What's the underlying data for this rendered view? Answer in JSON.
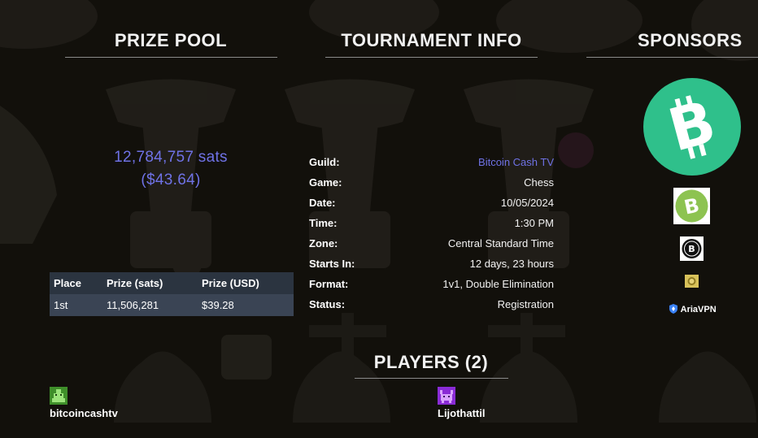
{
  "sections": {
    "prize_pool_title": "PRIZE POOL",
    "tournament_info_title": "TOURNAMENT INFO",
    "sponsors_title": "SPONSORS",
    "players_title": "PLAYERS (2)"
  },
  "prize_pool": {
    "sats": "12,784,757 sats",
    "usd": "($43.64)",
    "table": {
      "headers": [
        "Place",
        "Prize (sats)",
        "Prize (USD)"
      ],
      "rows": [
        [
          "1st",
          "11,506,281",
          "$39.28"
        ]
      ]
    }
  },
  "tournament_info": {
    "rows": [
      {
        "label": "Guild:",
        "value": "Bitcoin Cash TV",
        "is_link": true
      },
      {
        "label": "Game:",
        "value": "Chess"
      },
      {
        "label": "Date:",
        "value": "10/05/2024"
      },
      {
        "label": "Time:",
        "value": "1:30 PM"
      },
      {
        "label": "Zone:",
        "value": "Central Standard Time"
      },
      {
        "label": "Starts In:",
        "value": "12 days, 23 hours"
      },
      {
        "label": "Format:",
        "value": "1v1, Double Elimination"
      },
      {
        "label": "Status:",
        "value": "Registration"
      }
    ]
  },
  "sponsors": {
    "logos": [
      "bitcoin-cash-logo-large",
      "bitcoin-cash-logo-small",
      "bitcoin-circle-logo",
      "gold-coin-logo",
      "ariavpn-logo"
    ],
    "ariavpn_label": "AriaVPN"
  },
  "players": [
    {
      "name": "bitcoincashtv",
      "avatar_color": "#3f8f2a"
    },
    {
      "name": "Lijothattil",
      "avatar_color": "#8a2bd6"
    }
  ],
  "colors": {
    "accent_link": "#6f72e6",
    "bch_green": "#2fc08b",
    "table_header": "#2b3440",
    "table_row": "#3a4454"
  }
}
